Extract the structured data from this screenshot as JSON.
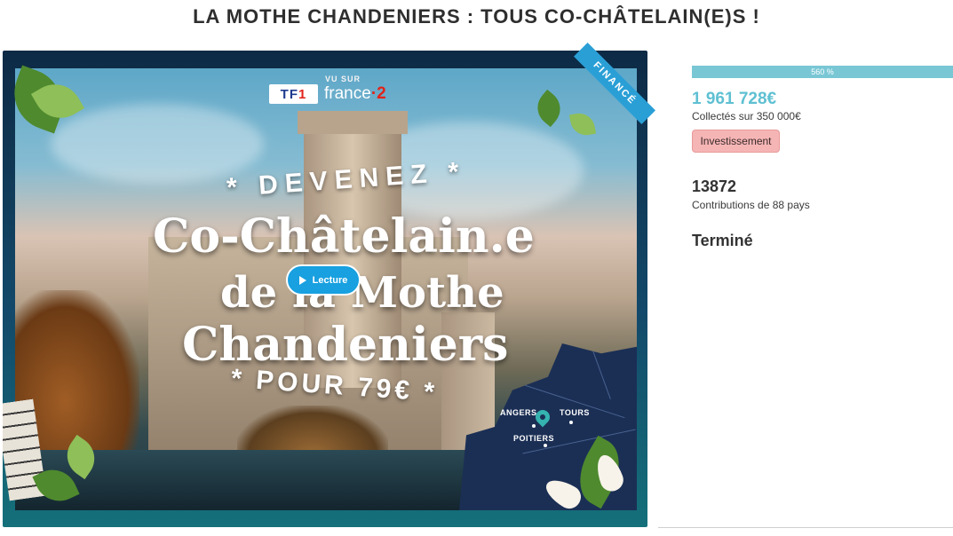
{
  "page": {
    "title": "LA MOTHE CHANDENIERS : TOUS CO-CHÂTELAIN(E)S !"
  },
  "media": {
    "vu_sur": "VU SUR",
    "logo_tf1_a": "TF",
    "logo_tf1_b": "1",
    "logo_france": "france",
    "logo_two": "·2",
    "ribbon": "FINANCÉ",
    "poster": {
      "line_devenez": "* DEVENEZ *",
      "line_1": "Co-Châtelain.e",
      "line_2": "de la Mothe",
      "line_3": "Chandeniers",
      "line_pour": "* POUR 79€ *"
    },
    "play_button_label": "Lecture",
    "map": {
      "city_1": "ANGERS",
      "city_2": "TOURS",
      "city_3": "POITIERS"
    }
  },
  "campaign": {
    "progress_percent": 560,
    "progress_label": "560 %",
    "amount_raised": "1 961 728€",
    "goal_text": "Collectés sur 350 000€",
    "category_badge": "Investissement",
    "contributions_count": "13872",
    "contributions_text": "Contributions de 88 pays",
    "status": "Terminé"
  },
  "colors": {
    "accent": "#5fc0d2",
    "progress": "#79c7d5",
    "badge_bg": "#f6b5b5",
    "play_button": "#18a0e0"
  }
}
